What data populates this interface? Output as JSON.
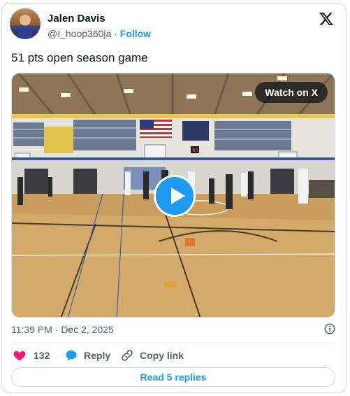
{
  "author": {
    "name": "Jalen Davis",
    "handle": "@I_hoop360ja",
    "separator": "·",
    "follow_label": "Follow"
  },
  "tweet": {
    "text": "51 pts open season game"
  },
  "media": {
    "watch_label": "Watch on X",
    "scoreboard_digit": "85"
  },
  "meta": {
    "timestamp": "11:39 PM · Dec 2, 2025"
  },
  "actions": {
    "like_count": "132",
    "reply_label": "Reply",
    "copy_link_label": "Copy link"
  },
  "replies_button": {
    "label": "Read 5 replies"
  },
  "colors": {
    "accent": "#1d9bf0",
    "like": "#f91880",
    "text_secondary": "#536471",
    "border": "#cfd9de"
  },
  "icons": [
    "x-logo-icon",
    "info-icon",
    "heart-icon",
    "reply-bubble-icon",
    "link-icon",
    "play-icon"
  ]
}
